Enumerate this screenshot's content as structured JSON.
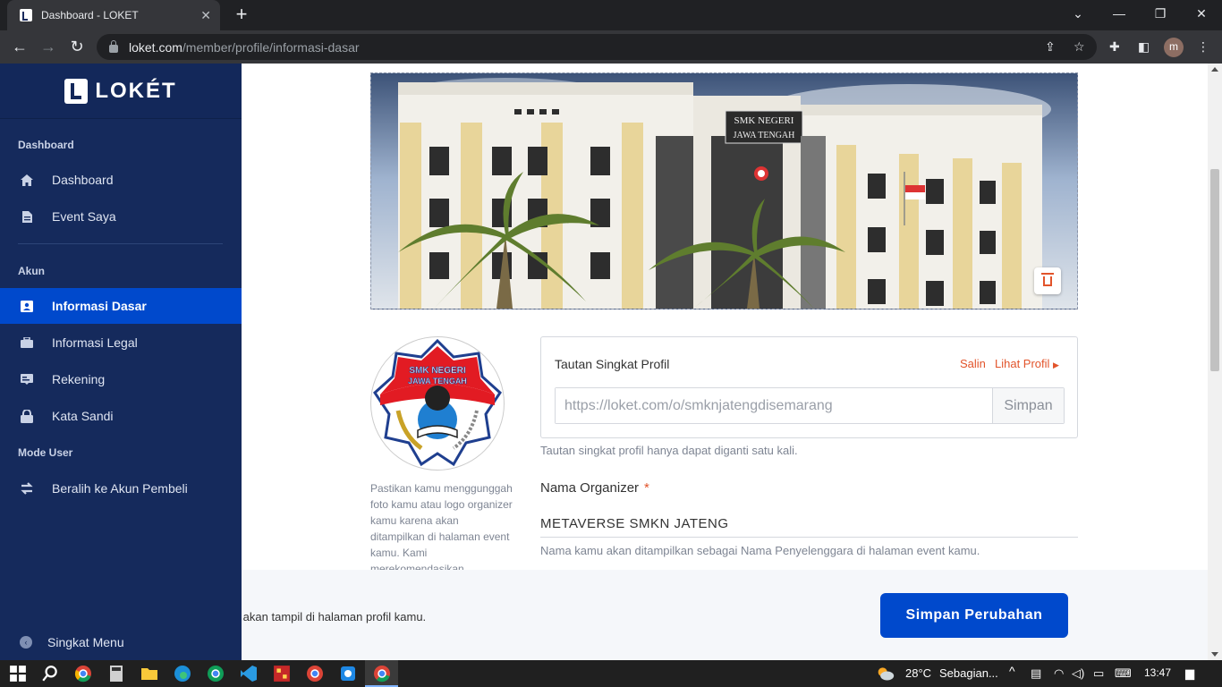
{
  "browser": {
    "tab_title": "Dashboard - LOKET",
    "url_host": "loket.com",
    "url_path": "/member/profile/informasi-dasar",
    "profile_initial": "m"
  },
  "sidebar": {
    "logo_text": "LOKÉT",
    "sections": {
      "dashboard": "Dashboard",
      "akun": "Akun",
      "mode_user": "Mode User"
    },
    "items": [
      {
        "label": "Dashboard",
        "icon": "home-icon"
      },
      {
        "label": "Event Saya",
        "icon": "document-icon"
      },
      {
        "label": "Informasi Dasar",
        "icon": "id-card-icon",
        "active": true
      },
      {
        "label": "Informasi Legal",
        "icon": "briefcase-icon"
      },
      {
        "label": "Rekening",
        "icon": "bank-card-icon"
      },
      {
        "label": "Kata Sandi",
        "icon": "lock-icon"
      },
      {
        "label": "Beralih ke Akun Pembeli",
        "icon": "swap-icon"
      }
    ],
    "collapse_label": "Singkat Menu"
  },
  "banner": {
    "sign_line1": "SMK NEGERI",
    "sign_line2": "JAWA TENGAH"
  },
  "logo": {
    "text_line1": "SMK NEGERI",
    "text_line2": "JAWA TENGAH",
    "help_text": "Pastikan kamu menggunggah foto kamu atau logo organizer kamu karena akan ditampilkan di halaman event kamu. Kami merekomendasikan"
  },
  "short_link": {
    "label": "Tautan Singkat Profil",
    "salin": "Salin",
    "lihat_profil": "Lihat Profil",
    "value": "https://loket.com/o/smknjatengdisemarang",
    "save_label": "Simpan",
    "help": "Tautan singkat profil hanya dapat diganti satu kali."
  },
  "organizer": {
    "label": "Nama Organizer",
    "required": "*",
    "value": "METAVERSE SMKN JATENG",
    "help": "Nama kamu akan ditampilkan sebagai Nama Penyelenggara di halaman event kamu."
  },
  "footer": {
    "text": "pat akan tampil di halaman profil kamu.",
    "save_label": "Simpan Perubahan"
  },
  "taskbar": {
    "temperature": "28°C",
    "weather": "Sebagian...",
    "time": "13:47"
  },
  "colors": {
    "sidebar_bg": "#152a5c",
    "active_item": "#0049cc",
    "accent_orange": "#e2542b",
    "primary_button": "#0049cc"
  }
}
